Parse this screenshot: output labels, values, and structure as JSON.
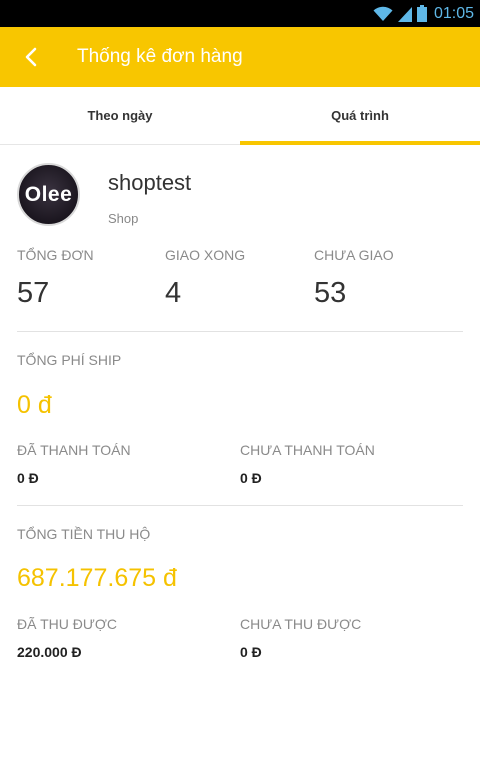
{
  "status_bar": {
    "time": "01:05",
    "icons": [
      "wifi-icon",
      "signal-icon",
      "battery-icon"
    ]
  },
  "app_bar": {
    "back_icon": "back-arrow-icon",
    "title": "Thống kê đơn hàng"
  },
  "tabs": [
    {
      "label": "Theo ngày",
      "active": false
    },
    {
      "label": "Quá trình",
      "active": true
    }
  ],
  "shop": {
    "avatar_text": "Olee",
    "name": "shoptest",
    "role": "Shop"
  },
  "orders": {
    "total_label": "TỔNG ĐƠN",
    "total_value": "57",
    "delivered_label": "GIAO XONG",
    "delivered_value": "4",
    "undelivered_label": "CHƯA GIAO",
    "undelivered_value": "53"
  },
  "ship_fee": {
    "label": "TỔNG PHÍ SHIP",
    "value": "0 đ",
    "paid_label": "ĐÃ THANH TOÁN",
    "paid_value": "0 Đ",
    "unpaid_label": "CHƯA THANH TOÁN",
    "unpaid_value": "0 Đ"
  },
  "cod": {
    "label": "TỔNG TIỀN THU HỘ",
    "value": "687.177.675 đ",
    "collected_label": "ĐÃ THU ĐƯỢC",
    "collected_value": "220.000 Đ",
    "uncollected_label": "CHƯA THU ĐƯỢC",
    "uncollected_value": "0 Đ"
  },
  "colors": {
    "accent": "#f8c600",
    "money": "#f5c200"
  }
}
